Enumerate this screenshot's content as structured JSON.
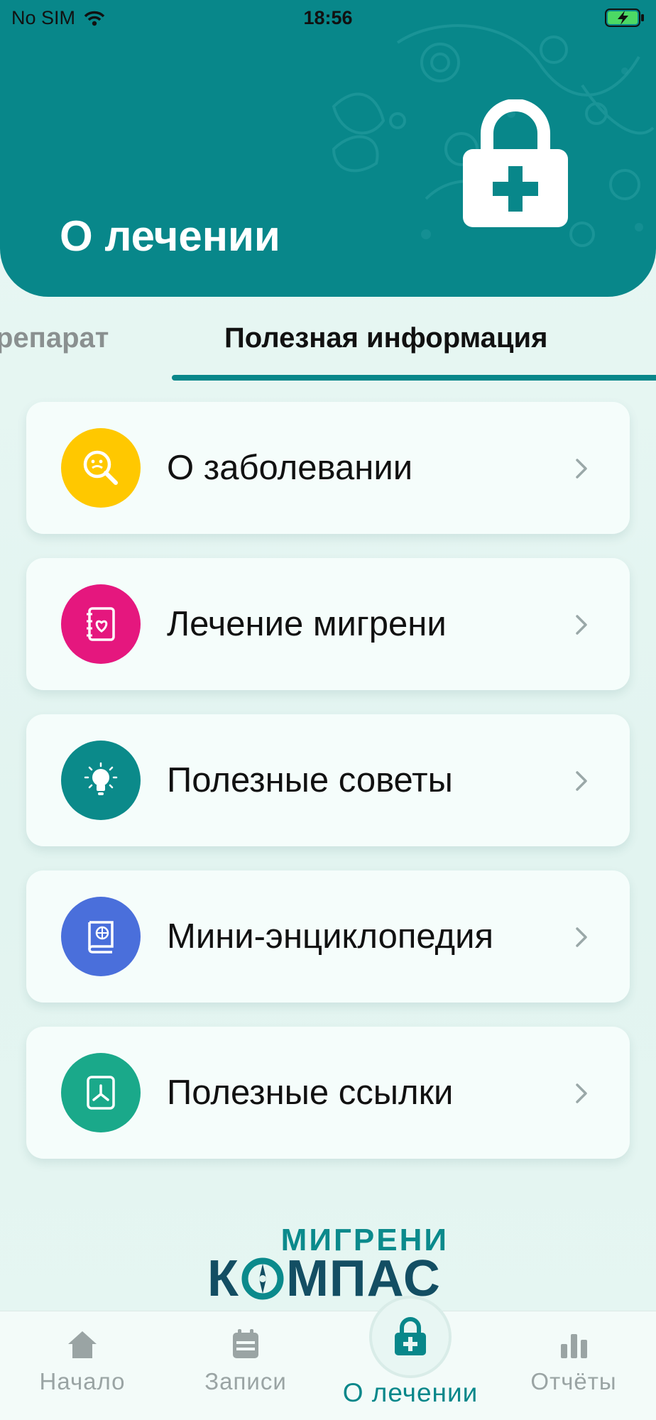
{
  "status_bar": {
    "carrier": "No SIM",
    "time": "18:56"
  },
  "header": {
    "title": "О лечении"
  },
  "tabs": {
    "previous": "репарат",
    "active": "Полезная информация"
  },
  "menu": [
    {
      "label": "О заболевании",
      "icon": "disease-search-icon",
      "color": "#ffc800"
    },
    {
      "label": "Лечение мигрени",
      "icon": "treatment-notebook-icon",
      "color": "#e5177e"
    },
    {
      "label": "Полезные советы",
      "icon": "lightbulb-icon",
      "color": "#0b8a8a"
    },
    {
      "label": "Мини-энциклопедия",
      "icon": "encyclopedia-book-icon",
      "color": "#4a6fdb"
    },
    {
      "label": "Полезные ссылки",
      "icon": "links-document-icon",
      "color": "#1aa98a"
    }
  ],
  "logo": {
    "top": "МИГРЕНИ",
    "bottom_left": "К",
    "bottom_right": "МПАС"
  },
  "nav": {
    "home": "Начало",
    "records": "Записи",
    "treatment": "О лечении",
    "reports": "Отчёты"
  },
  "colors": {
    "accent": "#08878a",
    "inactive": "#9aa4a4"
  }
}
